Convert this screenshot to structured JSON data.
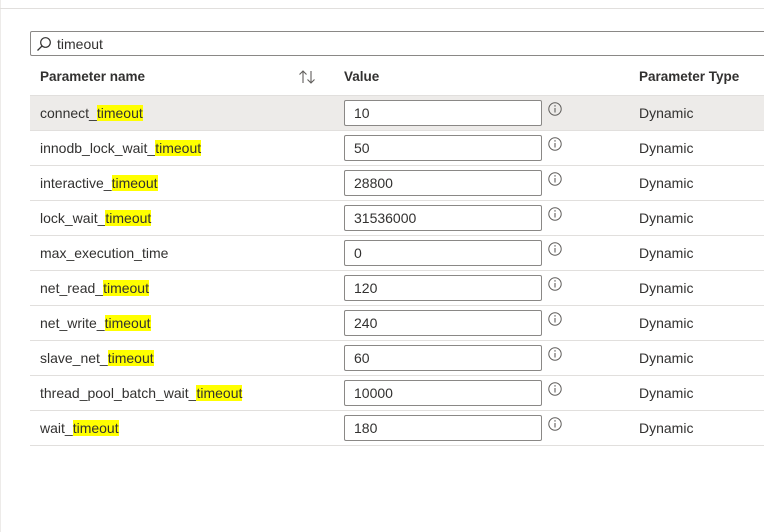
{
  "search": {
    "value": "timeout",
    "icon": "search-icon"
  },
  "table": {
    "headers": {
      "name": "Parameter name",
      "value": "Value",
      "type": "Parameter Type"
    },
    "highlight_color": "#ffff00",
    "selected_row_color": "#edebe9",
    "rows": [
      {
        "name_prefix": "connect_",
        "name_match": "timeout",
        "name_suffix": "",
        "value": "10",
        "type": "Dynamic",
        "selected": true
      },
      {
        "name_prefix": "innodb_lock_wait_",
        "name_match": "timeout",
        "name_suffix": "",
        "value": "50",
        "type": "Dynamic"
      },
      {
        "name_prefix": "interactive_",
        "name_match": "timeout",
        "name_suffix": "",
        "value": "28800",
        "type": "Dynamic"
      },
      {
        "name_prefix": "lock_wait_",
        "name_match": "timeout",
        "name_suffix": "",
        "value": "31536000",
        "type": "Dynamic"
      },
      {
        "name_prefix": "max_execution_time",
        "name_match": "",
        "name_suffix": "",
        "value": "0",
        "type": "Dynamic"
      },
      {
        "name_prefix": "net_read_",
        "name_match": "timeout",
        "name_suffix": "",
        "value": "120",
        "type": "Dynamic"
      },
      {
        "name_prefix": "net_write_",
        "name_match": "timeout",
        "name_suffix": "",
        "value": "240",
        "type": "Dynamic"
      },
      {
        "name_prefix": "slave_net_",
        "name_match": "timeout",
        "name_suffix": "",
        "value": "60",
        "type": "Dynamic"
      },
      {
        "name_prefix": "thread_pool_batch_wait_",
        "name_match": "timeout",
        "name_suffix": "",
        "value": "10000",
        "type": "Dynamic"
      },
      {
        "name_prefix": "wait_",
        "name_match": "timeout",
        "name_suffix": "",
        "value": "180",
        "type": "Dynamic"
      }
    ]
  }
}
